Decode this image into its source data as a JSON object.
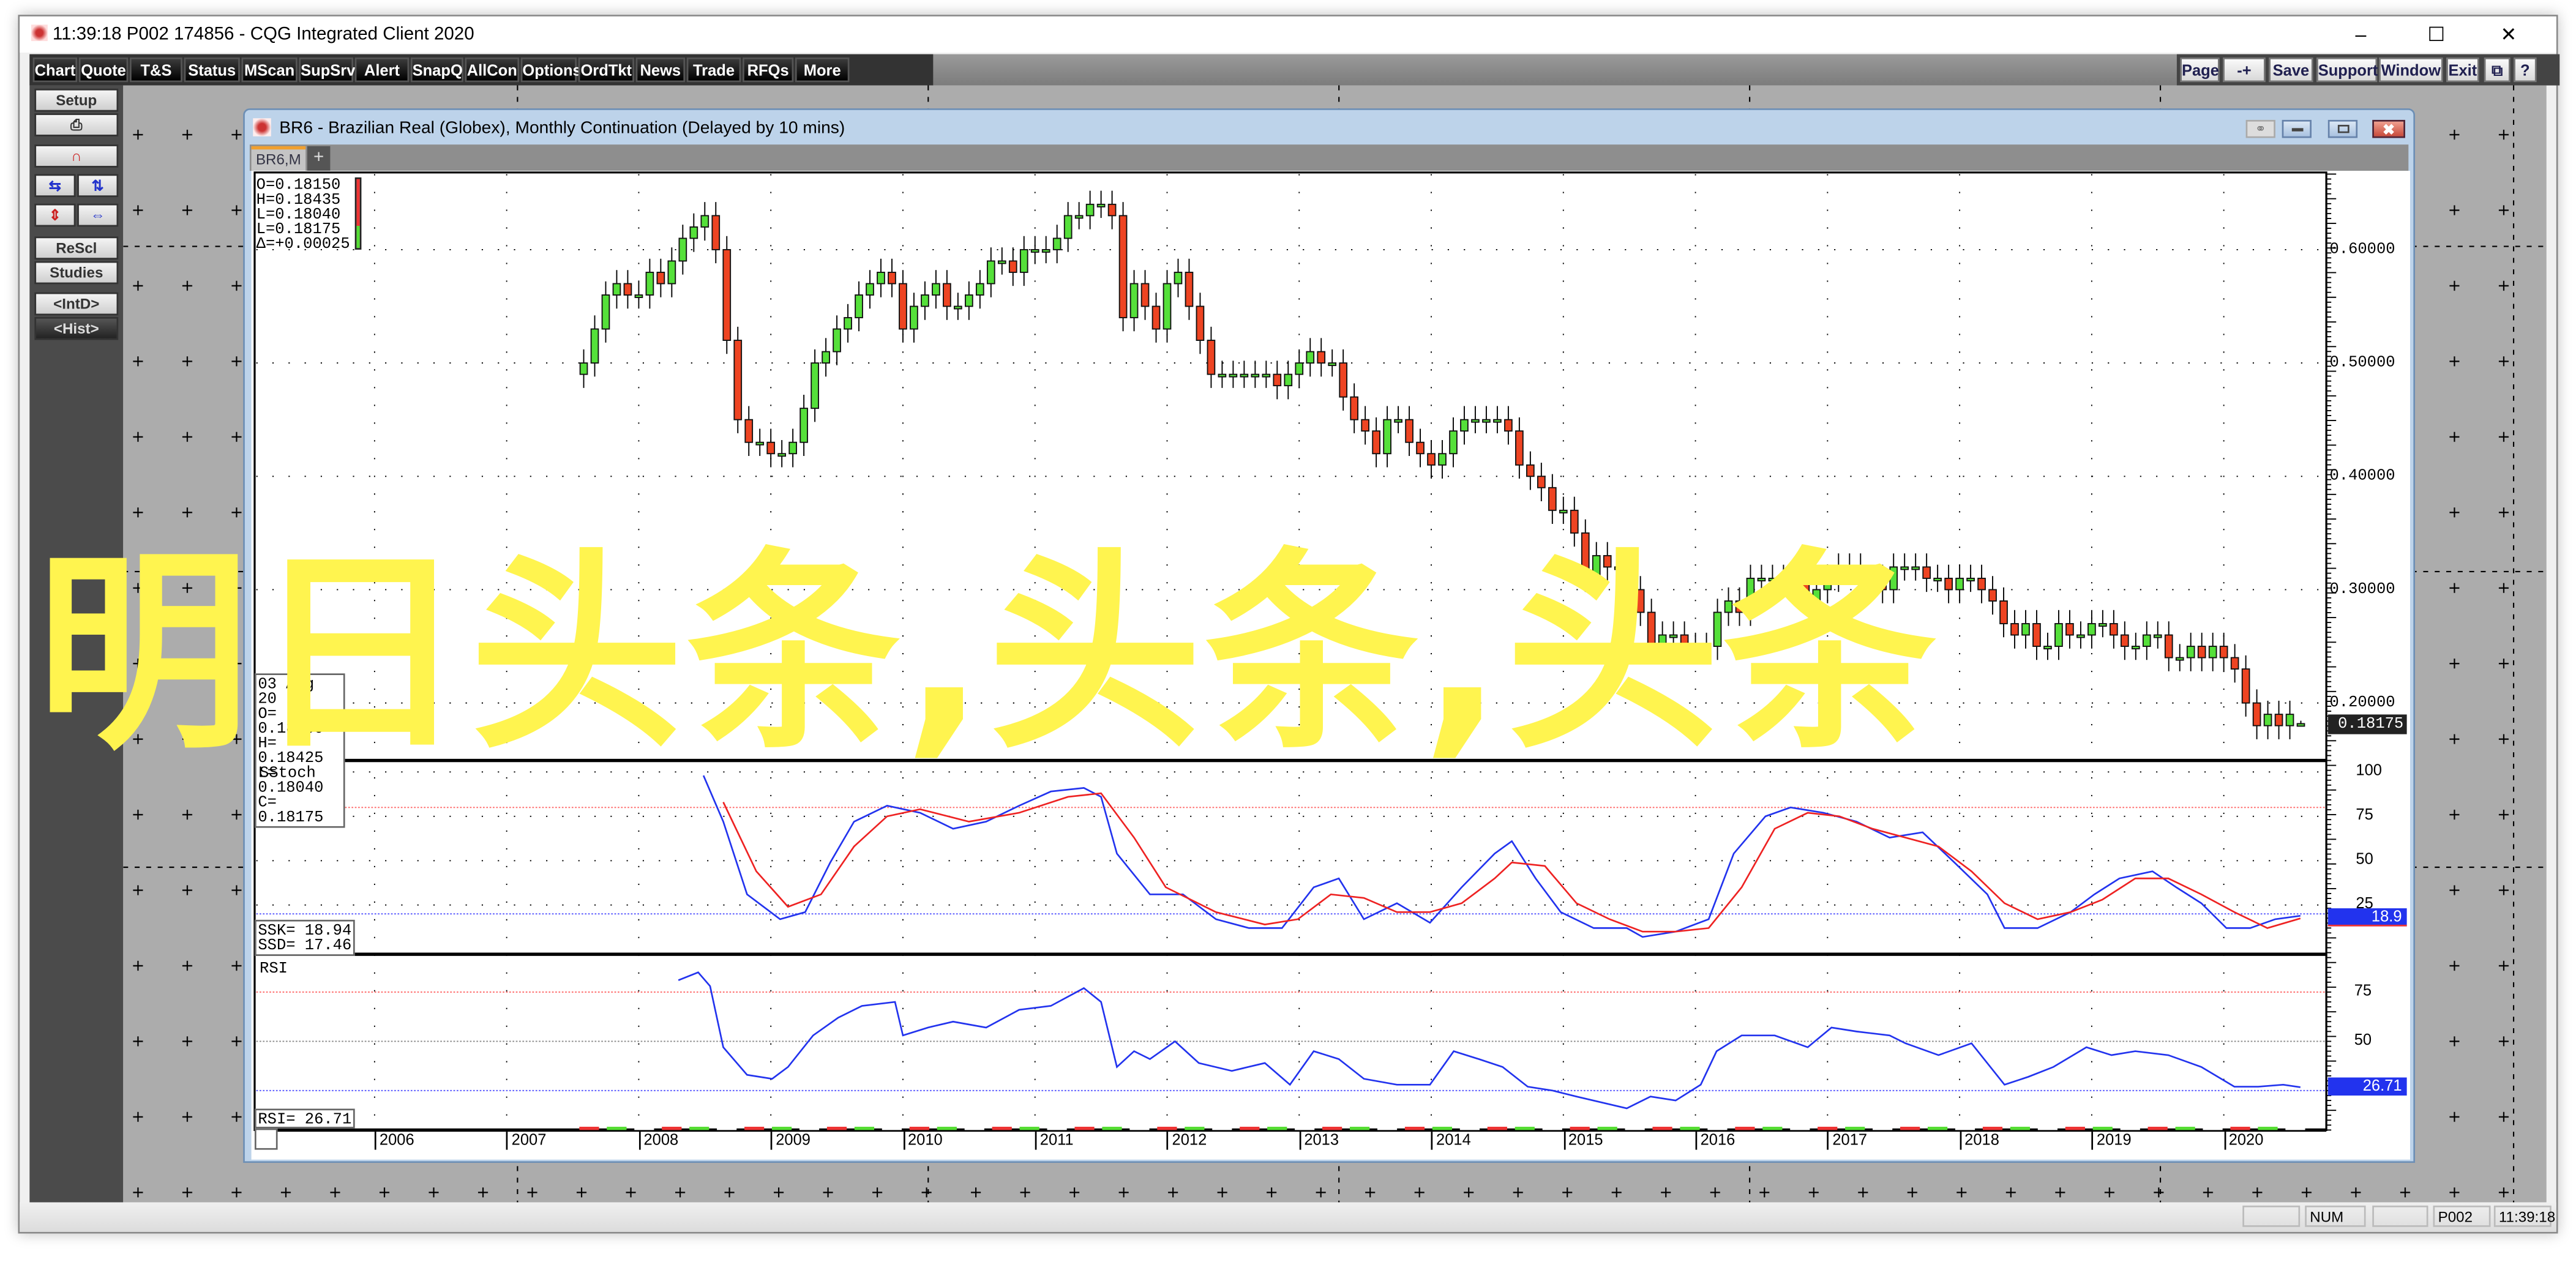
{
  "app": {
    "title": "11:39:18   P002   174856 - CQG Integrated Client 2020",
    "window_controls": [
      "minimize",
      "maximize",
      "close"
    ]
  },
  "menu": {
    "left": [
      "Chart",
      "Quote",
      "T&S",
      "Status",
      "MScan",
      "SupSrv",
      "Alert",
      "SnapQ",
      "AllCon",
      "Options",
      "OrdTkt",
      "News",
      "Trade",
      "RFQs",
      "More"
    ],
    "right": [
      "Page",
      "-+",
      "Save",
      "Support",
      "Window",
      "Exit",
      "⧉",
      "?"
    ]
  },
  "sidebar": {
    "setup": "Setup",
    "print_icon": "printer-icon",
    "magnet_icon": "magnet-icon",
    "rescl": "ReScl",
    "studies": "Studies",
    "intd": "<IntD>",
    "hist": "<Hist>"
  },
  "chart_window": {
    "title": "BR6 - Brazilian Real (Globex), Monthly Continuation (Delayed by 10 mins)",
    "tab": "BR6,M",
    "add_tab": "+"
  },
  "readout_current": [
    "O=0.18150",
    "H=0.18435",
    "L=0.18040",
    "L=0.18175",
    "Δ=+0.00025"
  ],
  "readout_cursor": [
    "03 Aug 20",
    "O= 0.18160",
    "H= 0.18425",
    "L= 0.18040",
    "C= 0.18175"
  ],
  "watermark": "明日头条,头条,头条",
  "colors": {
    "up": "#55e03a",
    "down": "#ee4422",
    "ssk": "#2233ee",
    "ssd": "#ee2222",
    "rsi": "#2233ee",
    "watermark": "#fff44f"
  },
  "chart_data": [
    {
      "type": "candlestick",
      "title": "BR6,M",
      "period": "monthly",
      "first_bar": "2007-08",
      "last_bar": "2020-08",
      "close": [
        0.5,
        0.53,
        0.56,
        0.57,
        0.56,
        0.56,
        0.58,
        0.57,
        0.59,
        0.61,
        0.62,
        0.63,
        0.6,
        0.52,
        0.45,
        0.43,
        0.43,
        0.42,
        0.42,
        0.43,
        0.46,
        0.5,
        0.51,
        0.53,
        0.54,
        0.56,
        0.57,
        0.58,
        0.57,
        0.53,
        0.55,
        0.56,
        0.57,
        0.55,
        0.55,
        0.56,
        0.57,
        0.59,
        0.59,
        0.58,
        0.6,
        0.6,
        0.6,
        0.61,
        0.63,
        0.63,
        0.64,
        0.64,
        0.63,
        0.54,
        0.57,
        0.55,
        0.53,
        0.57,
        0.58,
        0.55,
        0.52,
        0.49,
        0.49,
        0.49,
        0.49,
        0.49,
        0.49,
        0.48,
        0.49,
        0.5,
        0.51,
        0.5,
        0.5,
        0.47,
        0.45,
        0.44,
        0.42,
        0.45,
        0.45,
        0.43,
        0.42,
        0.41,
        0.42,
        0.44,
        0.45,
        0.45,
        0.45,
        0.45,
        0.44,
        0.41,
        0.4,
        0.39,
        0.37,
        0.37,
        0.35,
        0.31,
        0.33,
        0.32,
        0.32,
        0.3,
        0.28,
        0.25,
        0.26,
        0.26,
        0.25,
        0.25,
        0.25,
        0.28,
        0.29,
        0.28,
        0.31,
        0.31,
        0.31,
        0.31,
        0.31,
        0.29,
        0.3,
        0.31,
        0.32,
        0.32,
        0.31,
        0.31,
        0.3,
        0.32,
        0.32,
        0.32,
        0.31,
        0.31,
        0.3,
        0.31,
        0.31,
        0.3,
        0.29,
        0.27,
        0.26,
        0.27,
        0.25,
        0.25,
        0.27,
        0.26,
        0.26,
        0.27,
        0.27,
        0.26,
        0.25,
        0.25,
        0.26,
        0.26,
        0.24,
        0.24,
        0.25,
        0.24,
        0.25,
        0.24,
        0.23,
        0.2,
        0.18,
        0.19,
        0.18,
        0.19,
        0.18175
      ],
      "last_bar_ohlc": {
        "open": 0.1815,
        "high": 0.18435,
        "low": 0.1804,
        "close": 0.18175
      },
      "y_ticks": [
        "0.60000",
        "0.50000",
        "0.40000",
        "0.30000",
        "0.20000"
      ],
      "last_price_label": "0.18175",
      "ylim": [
        0.16,
        0.67
      ]
    },
    {
      "type": "line",
      "title": "SStoch",
      "y_ticks": [
        "100",
        "75",
        "50",
        "25"
      ],
      "ylim": [
        0,
        100
      ],
      "value_label": "18.9",
      "legend": [
        {
          "label": "SSK=",
          "value": "18.94"
        },
        {
          "label": "SSD=",
          "value": "17.46"
        }
      ],
      "series": [
        {
          "name": "SSK",
          "points": [
            [
              2008.49,
              98
            ],
            [
              2008.64,
              72
            ],
            [
              2008.82,
              31
            ],
            [
              2009.07,
              17
            ],
            [
              2009.26,
              21
            ],
            [
              2009.45,
              49
            ],
            [
              2009.63,
              72
            ],
            [
              2009.88,
              81
            ],
            [
              2010.13,
              77
            ],
            [
              2010.38,
              68
            ],
            [
              2010.63,
              72
            ],
            [
              2010.88,
              81
            ],
            [
              2011.12,
              89
            ],
            [
              2011.37,
              91
            ],
            [
              2011.5,
              86
            ],
            [
              2011.62,
              54
            ],
            [
              2011.87,
              31
            ],
            [
              2012.12,
              31
            ],
            [
              2012.37,
              17
            ],
            [
              2012.62,
              12
            ],
            [
              2012.87,
              12
            ],
            [
              2013.11,
              35
            ],
            [
              2013.3,
              40
            ],
            [
              2013.49,
              17
            ],
            [
              2013.74,
              26
            ],
            [
              2013.99,
              15
            ],
            [
              2014.23,
              35
            ],
            [
              2014.48,
              54
            ],
            [
              2014.61,
              61
            ],
            [
              2014.79,
              40
            ],
            [
              2014.98,
              21
            ],
            [
              2015.23,
              12
            ],
            [
              2015.48,
              12
            ],
            [
              2015.6,
              7
            ],
            [
              2015.85,
              10
            ],
            [
              2016.1,
              17
            ],
            [
              2016.29,
              54
            ],
            [
              2016.53,
              75
            ],
            [
              2016.72,
              80
            ],
            [
              2016.97,
              77
            ],
            [
              2017.22,
              72
            ],
            [
              2017.47,
              63
            ],
            [
              2017.72,
              66
            ],
            [
              2017.96,
              49
            ],
            [
              2018.21,
              31
            ],
            [
              2018.34,
              12
            ],
            [
              2018.59,
              12
            ],
            [
              2018.84,
              21
            ],
            [
              2019.02,
              31
            ],
            [
              2019.21,
              40
            ],
            [
              2019.46,
              44
            ],
            [
              2019.64,
              35
            ],
            [
              2019.83,
              26
            ],
            [
              2020.02,
              12
            ],
            [
              2020.2,
              12
            ],
            [
              2020.39,
              17
            ],
            [
              2020.58,
              18.94
            ]
          ]
        },
        {
          "name": "SSD",
          "points": [
            [
              2008.64,
              83
            ],
            [
              2008.89,
              44
            ],
            [
              2009.13,
              24
            ],
            [
              2009.38,
              31
            ],
            [
              2009.63,
              58
            ],
            [
              2009.88,
              75
            ],
            [
              2010.13,
              79
            ],
            [
              2010.5,
              72
            ],
            [
              2010.88,
              77
            ],
            [
              2011.25,
              86
            ],
            [
              2011.5,
              88
            ],
            [
              2011.75,
              63
            ],
            [
              2011.99,
              35
            ],
            [
              2012.37,
              21
            ],
            [
              2012.74,
              14
            ],
            [
              2012.99,
              17
            ],
            [
              2013.24,
              31
            ],
            [
              2013.49,
              29
            ],
            [
              2013.74,
              21
            ],
            [
              2013.99,
              21
            ],
            [
              2014.23,
              26
            ],
            [
              2014.48,
              40
            ],
            [
              2014.61,
              49
            ],
            [
              2014.86,
              47
            ],
            [
              2015.1,
              26
            ],
            [
              2015.35,
              17
            ],
            [
              2015.6,
              10
            ],
            [
              2015.85,
              10
            ],
            [
              2016.1,
              12
            ],
            [
              2016.35,
              35
            ],
            [
              2016.6,
              68
            ],
            [
              2016.85,
              77
            ],
            [
              2017.09,
              75
            ],
            [
              2017.34,
              68
            ],
            [
              2017.59,
              63
            ],
            [
              2017.84,
              58
            ],
            [
              2018.09,
              44
            ],
            [
              2018.34,
              26
            ],
            [
              2018.59,
              17
            ],
            [
              2018.84,
              21
            ],
            [
              2019.08,
              28
            ],
            [
              2019.33,
              40
            ],
            [
              2019.58,
              40
            ],
            [
              2019.83,
              31
            ],
            [
              2020.08,
              21
            ],
            [
              2020.33,
              12
            ],
            [
              2020.58,
              17.46
            ]
          ]
        }
      ]
    },
    {
      "type": "line",
      "title": "RSI",
      "y_ticks": [
        "75",
        "50"
      ],
      "ylim": [
        10,
        90
      ],
      "value_label": "26.71",
      "legend": [
        {
          "label": "RSI=",
          "value": "26.71"
        }
      ],
      "series": [
        {
          "name": "RSI",
          "points": [
            [
              2008.3,
              81
            ],
            [
              2008.45,
              85
            ],
            [
              2008.54,
              78
            ],
            [
              2008.64,
              47
            ],
            [
              2008.82,
              33
            ],
            [
              2009.01,
              31
            ],
            [
              2009.13,
              37
            ],
            [
              2009.32,
              53
            ],
            [
              2009.51,
              62
            ],
            [
              2009.69,
              68
            ],
            [
              2009.94,
              70
            ],
            [
              2010.0,
              53
            ],
            [
              2010.19,
              57
            ],
            [
              2010.38,
              60
            ],
            [
              2010.63,
              57
            ],
            [
              2010.88,
              66
            ],
            [
              2011.12,
              68
            ],
            [
              2011.37,
              77
            ],
            [
              2011.5,
              70
            ],
            [
              2011.62,
              37
            ],
            [
              2011.75,
              45
            ],
            [
              2011.87,
              41
            ],
            [
              2012.06,
              50
            ],
            [
              2012.24,
              39
            ],
            [
              2012.49,
              35
            ],
            [
              2012.74,
              39
            ],
            [
              2012.93,
              28
            ],
            [
              2013.11,
              45
            ],
            [
              2013.3,
              41
            ],
            [
              2013.49,
              31
            ],
            [
              2013.74,
              28
            ],
            [
              2013.99,
              28
            ],
            [
              2014.17,
              45
            ],
            [
              2014.36,
              41
            ],
            [
              2014.54,
              37
            ],
            [
              2014.73,
              27
            ],
            [
              2014.92,
              25
            ],
            [
              2015.1,
              22
            ],
            [
              2015.29,
              19
            ],
            [
              2015.48,
              16
            ],
            [
              2015.66,
              22
            ],
            [
              2015.85,
              20
            ],
            [
              2016.04,
              28
            ],
            [
              2016.16,
              45
            ],
            [
              2016.35,
              53
            ],
            [
              2016.6,
              53
            ],
            [
              2016.85,
              47
            ],
            [
              2017.03,
              57
            ],
            [
              2017.22,
              55
            ],
            [
              2017.47,
              53
            ],
            [
              2017.59,
              49
            ],
            [
              2017.84,
              43
            ],
            [
              2018.09,
              49
            ],
            [
              2018.34,
              28
            ],
            [
              2018.52,
              32
            ],
            [
              2018.71,
              37
            ],
            [
              2018.96,
              47
            ],
            [
              2019.15,
              43
            ],
            [
              2019.33,
              45
            ],
            [
              2019.58,
              43
            ],
            [
              2019.83,
              37
            ],
            [
              2020.08,
              27
            ],
            [
              2020.26,
              27
            ],
            [
              2020.45,
              28
            ],
            [
              2020.58,
              26.71
            ]
          ]
        }
      ]
    },
    {
      "type": "axis",
      "x_ticks": [
        "2006",
        "2007",
        "2008",
        "2009",
        "2010",
        "2011",
        "2012",
        "2013",
        "2014",
        "2015",
        "2016",
        "2017",
        "2018",
        "2019",
        "2020"
      ]
    }
  ],
  "status": {
    "num": "NUM",
    "page": "P002",
    "time": "11:39:18"
  }
}
